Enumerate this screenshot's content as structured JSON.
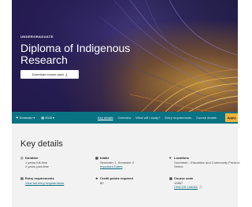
{
  "hero": {
    "eyebrow": "UNDERGRADUATE",
    "title": "Diploma of Indigenous Research",
    "download_label": "Download course pack",
    "download_icon": "download-icon"
  },
  "nav": {
    "location_label": "Domestic",
    "year_label": "2026",
    "links": [
      "Key details",
      "Overview",
      "What will I study?",
      "Entry requirements",
      "Course details"
    ],
    "apply_label": "Apply"
  },
  "key_details": {
    "heading": "Key details",
    "duration": {
      "label": "Duration",
      "values": [
        "1 years full-time",
        "2 years part-time"
      ]
    },
    "intake": {
      "label": "Intake",
      "value": "Semester 1, Semester 2",
      "link": "Important Dates"
    },
    "locations": {
      "label": "Locations",
      "values": [
        "Ourimbah - Education and Community Precinct",
        "Online"
      ]
    },
    "entry": {
      "label": "Entry requirements",
      "link": "View full entry requirements"
    },
    "credit": {
      "label": "Credit points required",
      "value": "80"
    },
    "course_code": {
      "label": "Course code",
      "value": "10867",
      "link": "CRICOS 108061"
    }
  },
  "colors": {
    "nav_bg": "#0a7383",
    "apply_bg": "#f2b33d",
    "link": "#0a6a7a",
    "details_bg": "#f2f2f2"
  }
}
